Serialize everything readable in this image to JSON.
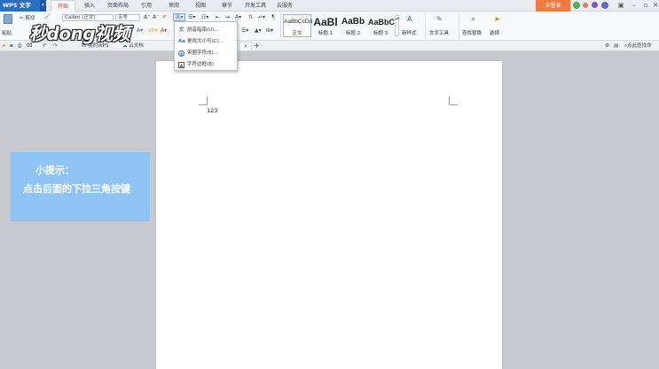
{
  "app": {
    "name": "WPS 文字",
    "login_label": "未登录"
  },
  "menu_tabs": [
    "开始",
    "插入",
    "页面布局",
    "引用",
    "审阅",
    "视图",
    "章节",
    "开发工具",
    "云服务"
  ],
  "ribbon": {
    "paste_label": "粘贴",
    "cut_label": "剪切",
    "format_painter_label": "格式刷",
    "font_name": "Calibri (正文)",
    "font_size": "五号",
    "styles": [
      {
        "sample": "AaBbCcDd",
        "label": "正文"
      },
      {
        "sample": "AaBl",
        "label": "标题 1"
      },
      {
        "sample": "AaBb",
        "label": "标题 2"
      },
      {
        "sample": "AaBbC",
        "label": "标题 3"
      }
    ],
    "new_style_label": "新样式",
    "text_tools_label": "文字工具",
    "find_replace_label": "查找替换",
    "select_label": "选择"
  },
  "doc_tabs": {
    "my_wps": "我的WPS",
    "cloud_doc": "云文档"
  },
  "search_placeholder": "点此查找命",
  "dropdown_items": [
    {
      "icon": "pinyin-icon",
      "label": "拼音指南(U)..."
    },
    {
      "icon": "change-case-icon",
      "label": "更改大小写(C)..."
    },
    {
      "icon": "enclose-char-icon",
      "label": "带圈字符(E)..."
    },
    {
      "icon": "char-border-icon",
      "label": "字符边框(B)"
    }
  ],
  "document": {
    "body_text": "123"
  },
  "tip": {
    "title": "小提示：",
    "text": "点击后面的下拉三角按键"
  },
  "watermark": "秒dong视频",
  "colors": {
    "accent": "#2b6fc4",
    "login": "#f07a42",
    "tip_bg": "#8ec3f4",
    "workspace": "#c7c9cf"
  }
}
